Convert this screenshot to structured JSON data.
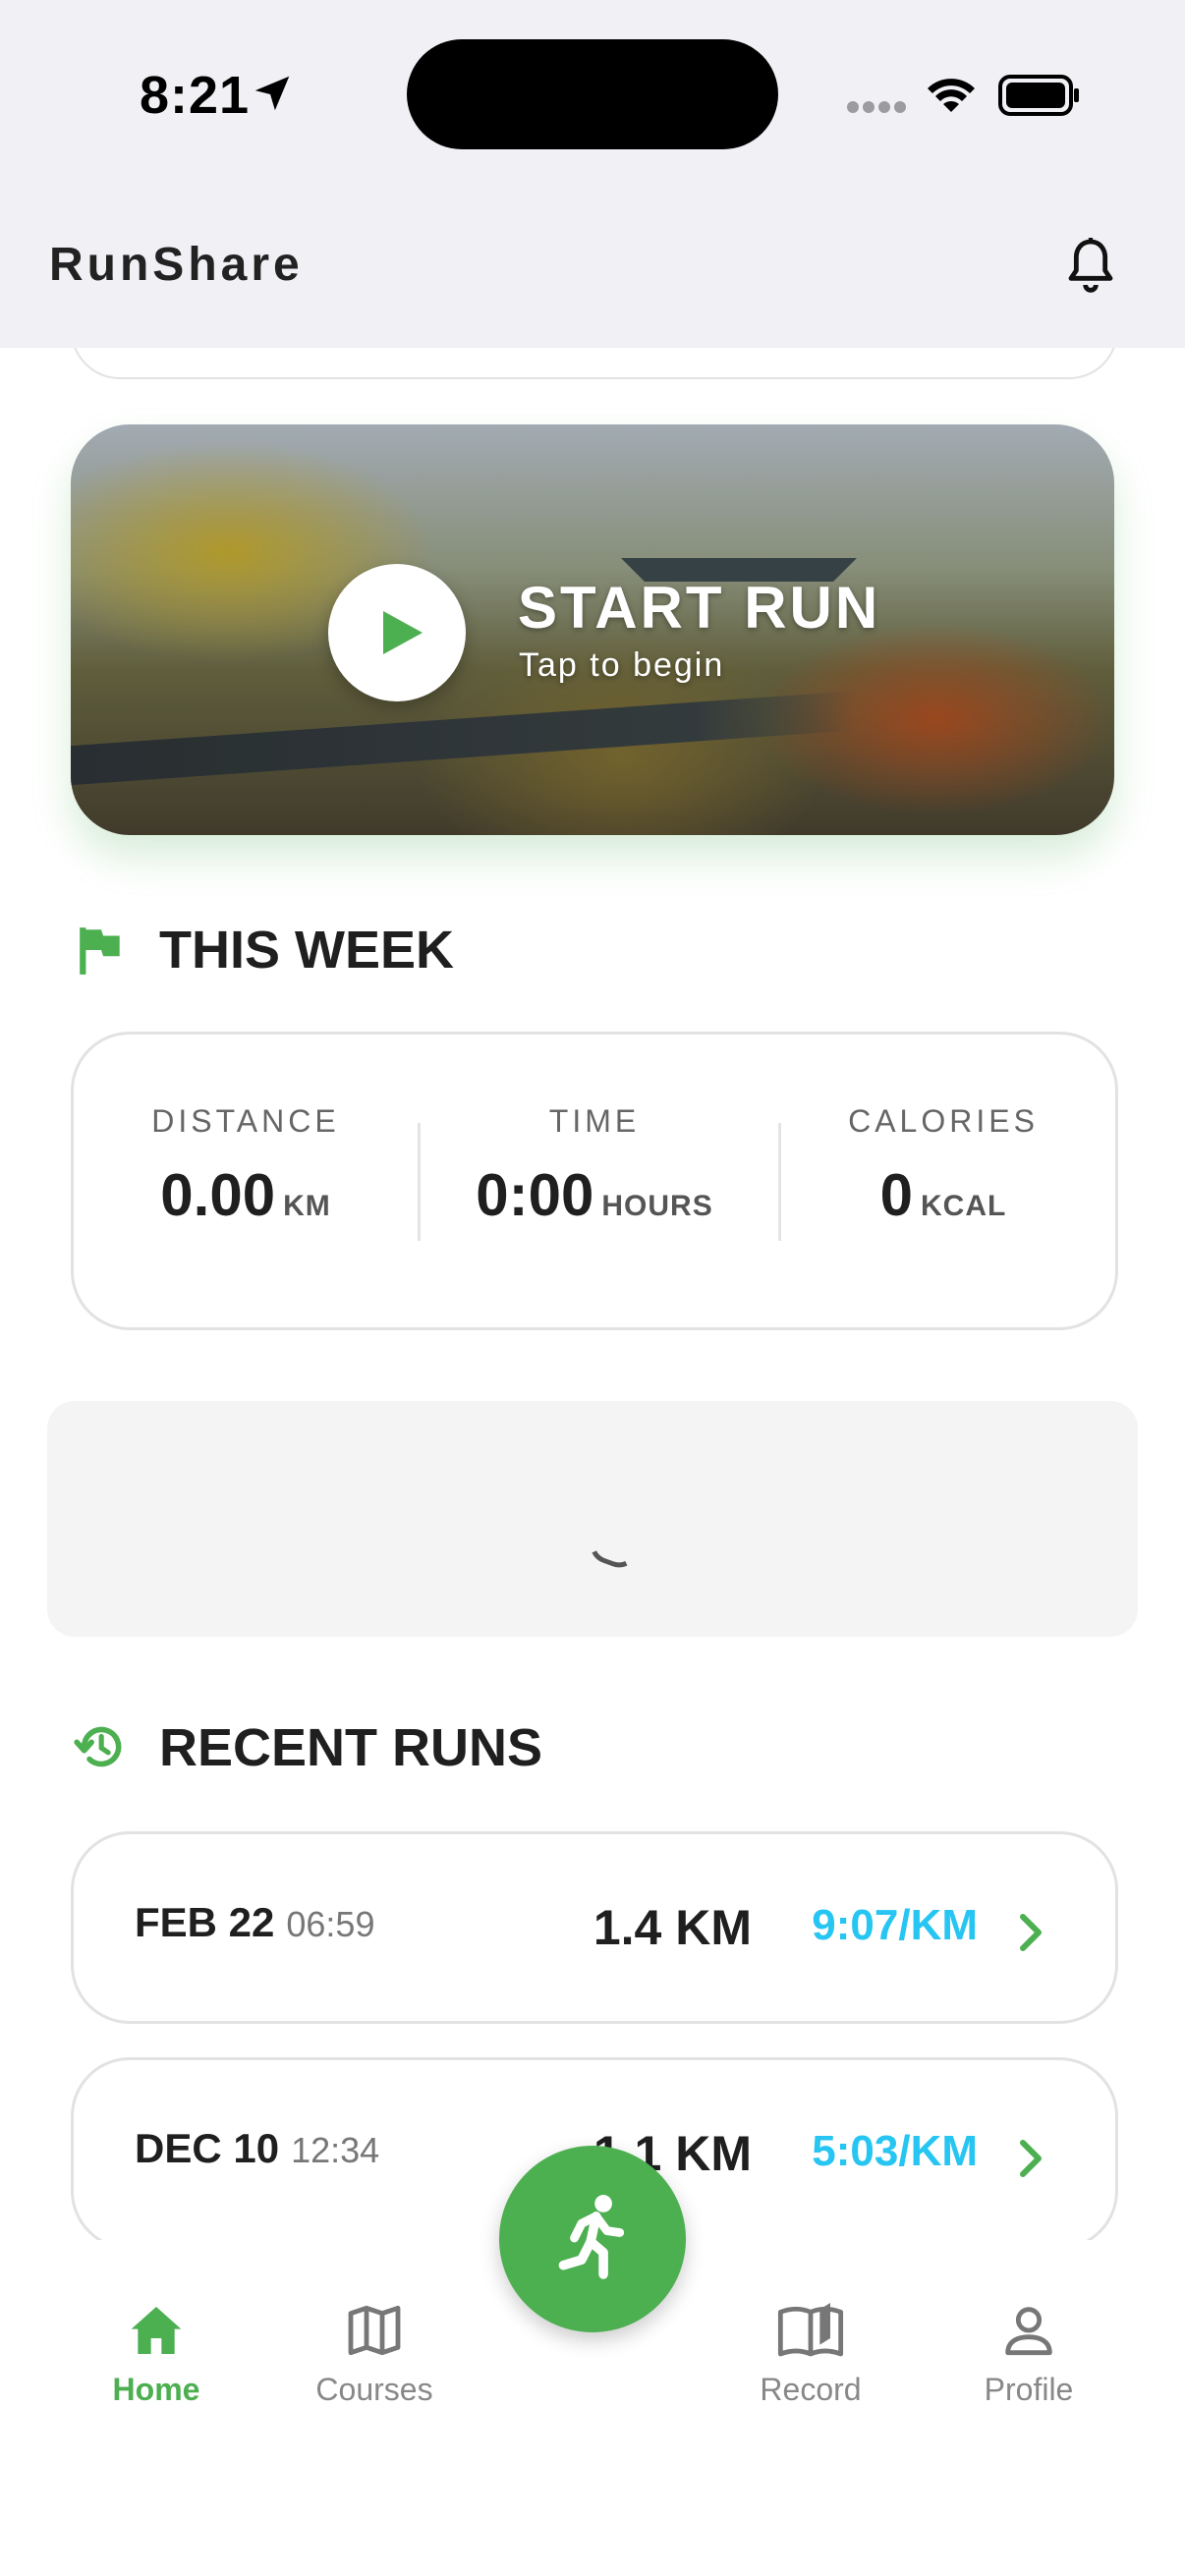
{
  "status_bar": {
    "time": "8:21"
  },
  "header": {
    "app_title": "RunShare"
  },
  "hero": {
    "title": "START RUN",
    "subtitle": "Tap to begin"
  },
  "this_week": {
    "section_title": "THIS WEEK",
    "stats": [
      {
        "label": "DISTANCE",
        "value": "0.00",
        "unit": "KM"
      },
      {
        "label": "TIME",
        "value": "0:00",
        "unit": "HOURS"
      },
      {
        "label": "CALORIES",
        "value": "0",
        "unit": "KCAL"
      }
    ]
  },
  "recent_runs": {
    "section_title": "RECENT RUNS",
    "runs": [
      {
        "date": "FEB 22",
        "time": "06:59",
        "distance": "1.4 KM",
        "pace": "9:07/KM"
      },
      {
        "date": "DEC 10",
        "time": "12:34",
        "distance": "1.1 KM",
        "pace": "5:03/KM"
      }
    ]
  },
  "bottom_nav": {
    "items": [
      {
        "label": "Home",
        "icon": "home-icon",
        "active": true
      },
      {
        "label": "Courses",
        "icon": "map-icon",
        "active": false
      },
      {
        "label": "Record",
        "icon": "book-icon",
        "active": false
      },
      {
        "label": "Profile",
        "icon": "person-icon",
        "active": false
      }
    ]
  },
  "colors": {
    "accent": "#4caf50",
    "pace": "#27c5f2",
    "header_bg": "#f0f0f5"
  }
}
